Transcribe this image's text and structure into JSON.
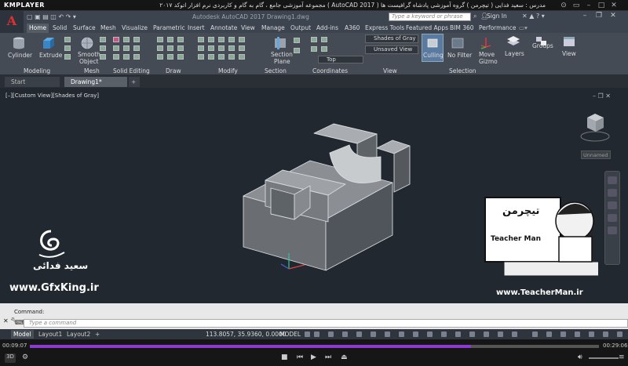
{
  "player": {
    "logo": "KMPLAYER",
    "title": "مجموعه آموزشی جامع ، گام به گام و کاربردی نرم افزار   اتوکد ۲۰۱۷  ( AutoCAD 2017 )   مدرس : سعید فدایی ( تیچرمن ) گروه آموزشی پادشاه گرافیست ها",
    "current_time": "00:09:07",
    "total_time": "00:29:06",
    "progress": 0.775
  },
  "acad": {
    "app_button": "A",
    "doc_title": "Autodesk AutoCAD 2017   Drawing1.dwg",
    "search_placeholder": "Type a keyword or phrase",
    "signin": "Sign In"
  },
  "ribbon_tabs": [
    "Home",
    "Solid",
    "Surface",
    "Mesh",
    "Visualize",
    "Parametric",
    "Insert",
    "Annotate",
    "View",
    "Manage",
    "Output",
    "Add-ins",
    "A360",
    "Express Tools",
    "Featured Apps",
    "BIM 360",
    "Performance"
  ],
  "ribbon": {
    "cylinder": "Cylinder",
    "extrude": "Extrude",
    "smooth_object": "Smooth",
    "smooth_object2": "Object",
    "section_plane": "Section",
    "section_plane2": "Plane",
    "visual_style": "Shades of Gray",
    "saved_view": "Unsaved View",
    "view_dir": "Top",
    "culling": "Culling",
    "no_filter": "No Filter",
    "move_gizmo": "Move",
    "move_gizmo2": "Gizmo",
    "layers": "Layers",
    "groups": "Groups",
    "view": "View",
    "panels": {
      "modeling": "Modeling",
      "mesh": "Mesh",
      "solid_editing": "Solid Editing",
      "draw": "Draw",
      "modify": "Modify",
      "section": "Section",
      "coordinates": "Coordinates",
      "view": "View",
      "selection": "Selection"
    }
  },
  "file_tabs": [
    "Start",
    "Drawing1*"
  ],
  "viewport": {
    "label": "[–][Custom View][Shades of Gray]",
    "unnamed": "Unnamed"
  },
  "command": {
    "history": "Command:",
    "placeholder": "Type a command"
  },
  "status": {
    "tabs": [
      "Model",
      "Layout1",
      "Layout2"
    ],
    "coords": "113.8057, 35.9360, 0.0000",
    "model": "MODEL"
  },
  "watermarks": {
    "left_name": "سعید فدائی",
    "left_site": "www.GfxKing.ir",
    "right_brand": "تیچرمن",
    "right_brand2": "Teacher Man",
    "right_site": "www.TeacherMan.ir"
  }
}
